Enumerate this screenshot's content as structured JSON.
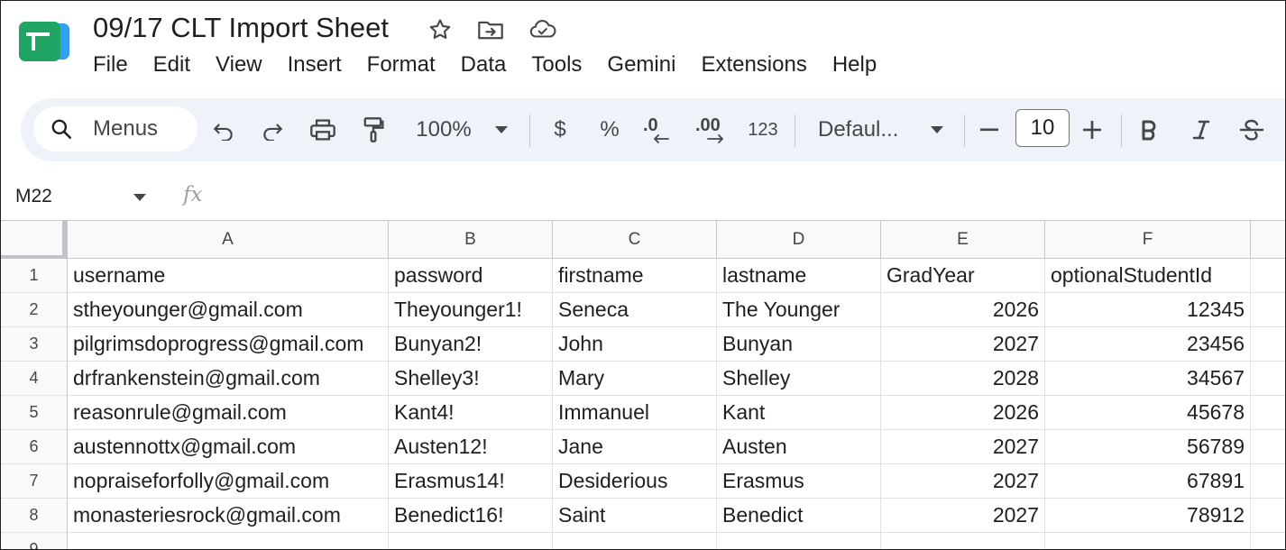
{
  "document": {
    "title": "09/17 CLT Import Sheet"
  },
  "menu": [
    "File",
    "Edit",
    "View",
    "Insert",
    "Format",
    "Data",
    "Tools",
    "Gemini",
    "Extensions",
    "Help"
  ],
  "toolbar": {
    "search_label": "Menus",
    "zoom": "100%",
    "currency": "$",
    "percent": "%",
    "decrease_decimal": ".0",
    "increase_decimal": ".00",
    "more_formats": "123",
    "font": "Defaul...",
    "font_size": "10"
  },
  "formula_bar": {
    "cell_ref": "M22",
    "fx_label": "fx"
  },
  "grid": {
    "columns": [
      "A",
      "B",
      "C",
      "D",
      "E",
      "F"
    ],
    "row_numbers": [
      "1",
      "2",
      "3",
      "4",
      "5",
      "6",
      "7",
      "8",
      "9"
    ],
    "rows": [
      [
        "username",
        "password",
        "firstname",
        "lastname",
        "GradYear",
        "optionalStudentId"
      ],
      [
        "stheyounger@gmail.com",
        "Theyounger1!",
        "Seneca",
        "The Younger",
        "2026",
        "12345"
      ],
      [
        "pilgrimsdoprogress@gmail.com",
        "Bunyan2!",
        "John",
        "Bunyan",
        "2027",
        "23456"
      ],
      [
        "drfrankenstein@gmail.com",
        "Shelley3!",
        "Mary",
        "Shelley",
        "2028",
        "34567"
      ],
      [
        "reasonrule@gmail.com",
        "Kant4!",
        "Immanuel",
        "Kant",
        "2026",
        "45678"
      ],
      [
        "austennottx@gmail.com",
        "Austen12!",
        "Jane",
        "Austen",
        "2027",
        "56789"
      ],
      [
        "nopraiseforfolly@gmail.com",
        "Erasmus14!",
        "Desiderious",
        "Erasmus",
        "2027",
        "67891"
      ],
      [
        "monasteriesrock@gmail.com",
        "Benedict16!",
        "Saint",
        "Benedict",
        "2027",
        "78912"
      ]
    ]
  },
  "colors": {
    "toolbar_bg": "#eef2f9",
    "header_bg": "#f8f9fa",
    "gridline": "#e1e1e1",
    "logo_green": "#1fa463"
  }
}
